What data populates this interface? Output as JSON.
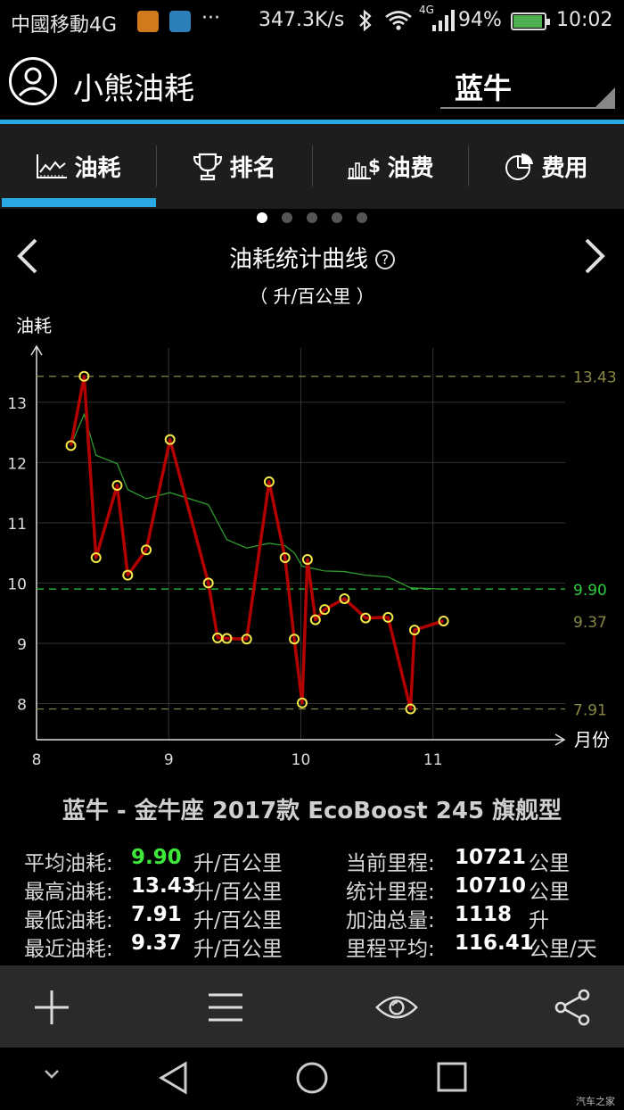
{
  "status_bar": {
    "carrier": "中國移動4G",
    "more": "···",
    "speed": "347.3K/s",
    "network": "4G",
    "battery_pct": "94%",
    "battery_level": 0.94,
    "time": "10:02"
  },
  "header": {
    "app_title": "小熊油耗",
    "car_name": "蓝牛"
  },
  "tabs": [
    {
      "label": "油耗",
      "icon": "line-chart-icon",
      "active": true
    },
    {
      "label": "排名",
      "icon": "trophy-icon",
      "active": false
    },
    {
      "label": "油费",
      "icon": "bar-dollar-icon",
      "active": false
    },
    {
      "label": "费用",
      "icon": "pie-chart-icon",
      "active": false
    }
  ],
  "pager": {
    "count": 5,
    "active": 0
  },
  "chart_header": {
    "title": "油耗统计曲线",
    "help": "?",
    "unit": "（ 升/百公里 ）"
  },
  "chart_data": {
    "type": "line",
    "ylabel": "油耗",
    "xlabel": "月份",
    "xlim": [
      8,
      12
    ],
    "ylim": [
      7.4,
      13.9
    ],
    "x_ticks": [
      "8",
      "9",
      "10",
      "11"
    ],
    "y_ticks": [
      "8",
      "9",
      "10",
      "11",
      "12",
      "13"
    ],
    "grid": true,
    "series": [
      {
        "color": "#b30000",
        "points": [
          [
            8.26,
            12.28
          ],
          [
            8.36,
            13.43
          ],
          [
            8.45,
            10.42
          ],
          [
            8.61,
            11.62
          ],
          [
            8.69,
            10.13
          ],
          [
            8.83,
            10.55
          ],
          [
            9.01,
            12.38
          ],
          [
            9.3,
            10.0
          ],
          [
            9.37,
            9.09
          ],
          [
            9.44,
            9.08
          ],
          [
            9.59,
            9.07
          ],
          [
            9.76,
            11.68
          ],
          [
            9.88,
            10.42
          ],
          [
            9.95,
            9.07
          ],
          [
            10.01,
            8.01
          ],
          [
            10.05,
            10.39
          ],
          [
            10.11,
            9.39
          ],
          [
            10.18,
            9.56
          ],
          [
            10.33,
            9.74
          ],
          [
            10.49,
            9.42
          ],
          [
            10.66,
            9.43
          ],
          [
            10.83,
            7.91
          ],
          [
            10.86,
            9.22
          ],
          [
            11.08,
            9.37
          ]
        ]
      },
      {
        "color": "#2e9a2e",
        "points": [
          [
            8.26,
            12.28
          ],
          [
            8.36,
            12.8
          ],
          [
            8.45,
            12.12
          ],
          [
            8.61,
            11.98
          ],
          [
            8.69,
            11.55
          ],
          [
            8.83,
            11.4
          ],
          [
            9.01,
            11.5
          ],
          [
            9.3,
            11.3
          ],
          [
            9.44,
            10.72
          ],
          [
            9.59,
            10.58
          ],
          [
            9.76,
            10.66
          ],
          [
            9.88,
            10.62
          ],
          [
            9.95,
            10.5
          ],
          [
            10.01,
            10.28
          ],
          [
            10.18,
            10.2
          ],
          [
            10.33,
            10.19
          ],
          [
            10.49,
            10.13
          ],
          [
            10.66,
            10.1
          ],
          [
            10.83,
            9.92
          ],
          [
            11.08,
            9.9
          ]
        ]
      }
    ],
    "reference_lines": [
      {
        "value": 13.43,
        "label": "13.43",
        "color": "#888844"
      },
      {
        "value": 9.9,
        "label": "9.90",
        "color": "#2ecc40"
      },
      {
        "value": 7.91,
        "label": "7.91",
        "color": "#888844"
      }
    ],
    "annotations": [
      {
        "value": 9.37,
        "label": "9.37",
        "color": "#888844"
      }
    ]
  },
  "vehicle_model": "蓝牛 - 金牛座 2017款 EcoBoost 245 旗舰型",
  "stats_left": [
    {
      "label": "平均油耗:",
      "value": "9.90",
      "unit": "升/百公里",
      "highlight": true
    },
    {
      "label": "最高油耗:",
      "value": "13.43",
      "unit": "升/百公里"
    },
    {
      "label": "最低油耗:",
      "value": "7.91",
      "unit": "升/百公里"
    },
    {
      "label": "最近油耗:",
      "value": "9.37",
      "unit": "升/百公里"
    }
  ],
  "stats_right": [
    {
      "label": "当前里程:",
      "value": "10721",
      "unit": "公里"
    },
    {
      "label": "统计里程:",
      "value": "10710",
      "unit": "公里"
    },
    {
      "label": "加油总量:",
      "value": "1118",
      "unit": "升"
    },
    {
      "label": "里程平均:",
      "value": "116.41",
      "unit": "公里/天"
    }
  ],
  "toolbar_icons": [
    "plus-icon",
    "menu-icon",
    "eye-icon",
    "share-icon"
  ],
  "watermark": "汽车之家"
}
